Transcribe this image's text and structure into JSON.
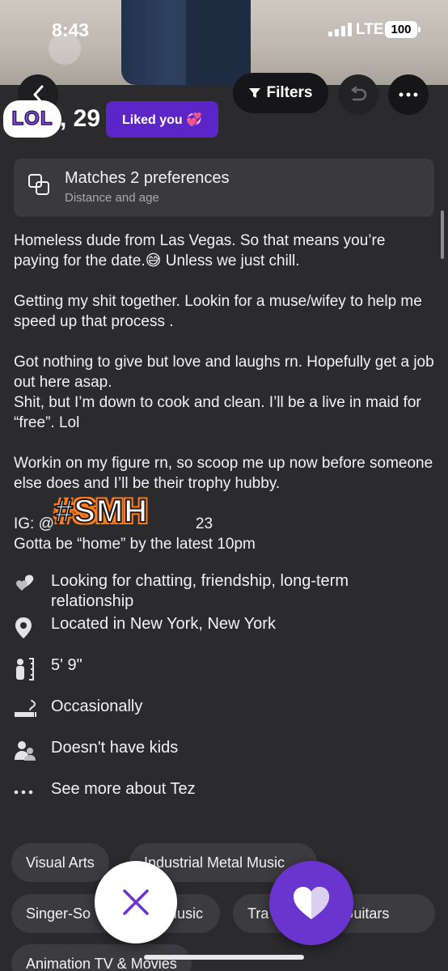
{
  "status_bar": {
    "time": "8:43",
    "network": "LTE",
    "battery": "100"
  },
  "top_controls": {
    "back_icon": "chevron-left-icon",
    "filters_label": "Filters",
    "filter_icon": "funnel-icon",
    "undo_icon": "undo-icon",
    "more_icon": "ellipsis-icon"
  },
  "profile": {
    "sticker_text": "LOL",
    "name_age": ", 29",
    "liked_badge": "Liked you 💞"
  },
  "match_card": {
    "title": "Matches 2 preferences",
    "subtitle": "Distance and age"
  },
  "bio": {
    "p1": "Homeless dude from Las Vegas. So that means you’re paying for the date.😅 Unless we just chill.",
    "p2": "Getting my shit together. Lookin for a muse/wifey to help me speed up that process .",
    "p3a": "Got nothing to give but love and laughs rn. Hopefully get a job out here asap.",
    "p3b": "Shit, but I’m down to cook and clean. I’ll be a live in maid for “free”. Lol",
    "p4": "Workin on my figure rn, so scoop me up now before someone else does and I’ll be their trophy hubby.",
    "ig_prefix": "IG: @",
    "ig_suffix": "23",
    "curfew": "Gotta be “home” by the latest 10pm",
    "sticker_smh": "#SMH"
  },
  "details": [
    {
      "icon": "hearts-icon",
      "text": "Looking for chatting, friendship, long-term relationship"
    },
    {
      "icon": "location-pin-icon",
      "text": "Located in New York, New York"
    },
    {
      "icon": "height-icon",
      "text": "5' 9\""
    },
    {
      "icon": "smoking-icon",
      "text": "Occasionally"
    },
    {
      "icon": "kids-icon",
      "text": "Doesn't have kids"
    },
    {
      "icon": "more-dots-icon",
      "text": "See more about Tez"
    }
  ],
  "tags": [
    "Visual Arts",
    "Industrial Metal Music",
    "Singer-So",
    "Music",
    "Tra",
    "ss Guitars",
    "Animation TV & Movies"
  ],
  "actions": {
    "pass_icon": "close-icon",
    "like_icon": "heart-icon"
  },
  "colors": {
    "background": "#2b2b2e",
    "accent": "#5b25c8",
    "like_button": "#6a34cf",
    "card": "#3a3a3e"
  }
}
